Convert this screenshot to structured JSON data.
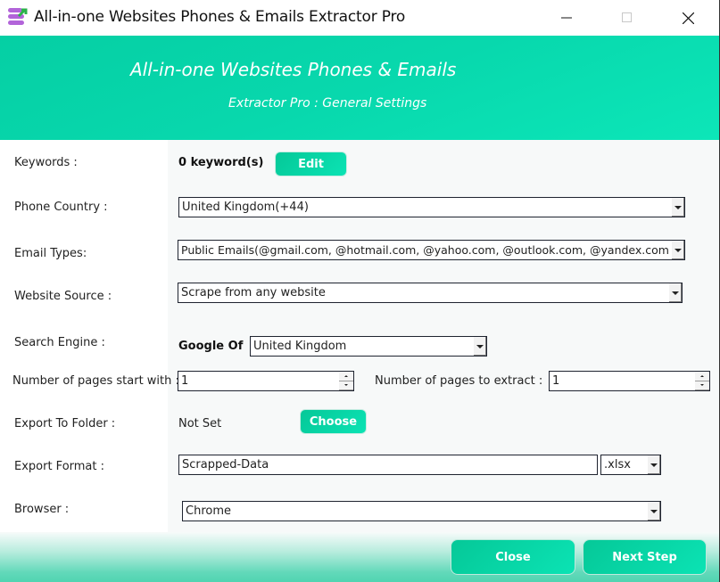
{
  "window": {
    "title": "All-in-one Websites Phones & Emails Extractor Pro",
    "controls": {
      "minimize": "minimize",
      "maximize": "maximize",
      "close": "close"
    }
  },
  "banner": {
    "title": "All-in-one Websites Phones & Emails",
    "subtitle": "Extractor Pro : General Settings",
    "color": "#08d8ad"
  },
  "form": {
    "keywords": {
      "label": "Keywords :",
      "value": "0 keyword(s)",
      "button": "Edit"
    },
    "phone_country": {
      "label": "Phone Country :",
      "value": "United Kingdom(+44)"
    },
    "email_types": {
      "label": "Email Types:",
      "value": "Public Emails(@gmail.com, @hotmail.com, @yahoo.com, @outlook.com, @yandex.com"
    },
    "website_source": {
      "label": "Website Source :",
      "value": "Scrape from any website"
    },
    "search_engine": {
      "label": "Search Engine :",
      "prefix": "Google Of",
      "value": "United Kingdom"
    },
    "pages_start": {
      "label": "Number of pages start with :",
      "value": "1"
    },
    "pages_extract": {
      "label": "Number of pages to extract :",
      "value": "1"
    },
    "export_folder": {
      "label": "Export To Folder :",
      "value": "Not Set",
      "button": "Choose"
    },
    "export_format": {
      "label": "Export Format :",
      "filename": "Scrapped-Data",
      "extension": ".xlsx"
    },
    "browser": {
      "label": "Browser :",
      "value": "Chrome"
    }
  },
  "footer": {
    "close": "Close",
    "next": "Next Step"
  }
}
